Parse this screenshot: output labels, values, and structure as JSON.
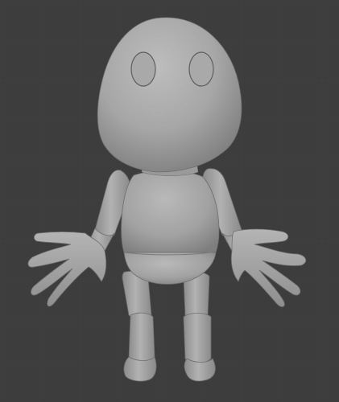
{
  "viewport": {
    "background_color": "#3d3d3d",
    "grid_line_color": "#454545",
    "show_grid": true
  },
  "model": {
    "material_color": "#a8a8a8",
    "shading": "solid-clay",
    "parts": [
      "head",
      "left-eye",
      "right-eye",
      "neck",
      "torso",
      "pelvis",
      "left-upper-arm",
      "left-forearm",
      "left-hand",
      "right-upper-arm",
      "right-forearm",
      "right-hand",
      "left-thigh",
      "left-shin",
      "left-foot",
      "right-thigh",
      "right-shin",
      "right-foot"
    ]
  }
}
